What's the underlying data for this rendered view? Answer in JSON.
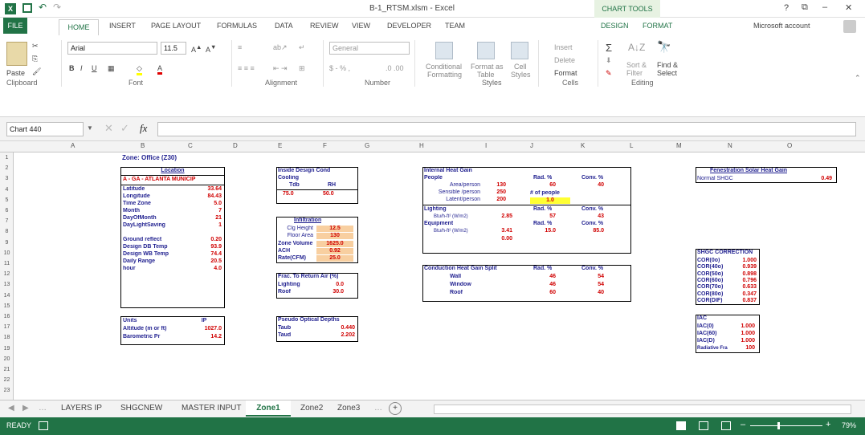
{
  "title": "B-1_RTSM.xlsm - Excel",
  "chart_tools": "CHART TOOLS",
  "window_buttons": {
    "help": "?",
    "restore": "⧉",
    "minimize": "–",
    "close": "✕"
  },
  "tabs": [
    "FILE",
    "HOME",
    "INSERT",
    "PAGE LAYOUT",
    "FORMULAS",
    "DATA",
    "REVIEW",
    "VIEW",
    "DEVELOPER",
    "TEAM",
    "DESIGN",
    "FORMAT"
  ],
  "account": "Microsoft account",
  "ribbon": {
    "paste": "Paste",
    "clipboard": "Clipboard",
    "font_name": "Arial",
    "font_size": "11.5",
    "font": "Font",
    "alignment": "Alignment",
    "number_format": "General",
    "number": "Number",
    "conditional": "Conditional",
    "formatting": "Formatting",
    "format_as": "Format as",
    "table": "Table",
    "cell": "Cell",
    "styles_btn": "Styles",
    "styles": "Styles",
    "insert": "Insert",
    "delete": "Delete",
    "format": "Format",
    "cells": "Cells",
    "sort": "Sort &",
    "filter": "Filter",
    "find": "Find &",
    "select": "Select",
    "editing": "Editing"
  },
  "formula_bar": {
    "name_box": "Chart 440",
    "fx": "fx",
    "value": ""
  },
  "columns": [
    "A",
    "B",
    "C",
    "D",
    "E",
    "F",
    "G",
    "H",
    "I",
    "J",
    "K",
    "L",
    "M",
    "N",
    "O"
  ],
  "rows": [
    "1",
    "2",
    "3",
    "4",
    "5",
    "6",
    "7",
    "8",
    "9",
    "10",
    "11",
    "12",
    "13",
    "14",
    "15",
    "16",
    "17",
    "18",
    "19",
    "20",
    "21",
    "22",
    "23"
  ],
  "zone": "Zone: Office (Z30)",
  "location": {
    "header": "Location",
    "name": "A - GA - ATLANTA MUNICIP",
    "rows": [
      [
        "Latitude",
        "33.64"
      ],
      [
        "Longitude",
        "84.43"
      ],
      [
        "Time Zone",
        "5.0"
      ],
      [
        "Month",
        "7"
      ],
      [
        "DayOfMonth",
        "21"
      ],
      [
        "DayLightSaving",
        "1"
      ],
      [
        "",
        ""
      ],
      [
        "Ground reflect",
        "0.20"
      ],
      [
        "Design DB Temp",
        "93.9"
      ],
      [
        "Design WB Temp",
        "74.4"
      ],
      [
        "Daily Range",
        "20.5"
      ],
      [
        "hour",
        "4.0"
      ]
    ]
  },
  "units": {
    "rows": [
      [
        "Units",
        "IP"
      ],
      [
        "Altitude (m or ft)",
        "1027.0"
      ],
      [
        "Barometric Pr",
        "14.2"
      ]
    ]
  },
  "inside": {
    "header": "Inside Design Cond",
    "cooling": "Cooling",
    "tdb": "Tdb",
    "rh": "RH",
    "tdb_val": "75.0",
    "rh_val": "50.0"
  },
  "infiltration": {
    "header": "Infiltration",
    "rows": [
      [
        "Clg Height",
        "12.5"
      ],
      [
        "Floor Area",
        "130"
      ],
      [
        "Zone Volume",
        "1625.0"
      ],
      [
        "ACH",
        "0.92"
      ],
      [
        "Rate(CFM)",
        "25.0"
      ]
    ]
  },
  "return_air": {
    "header": "Frac. To Return Air (%)",
    "rows": [
      [
        "Lighting",
        "0.0"
      ],
      [
        "Roof",
        "30.0"
      ]
    ]
  },
  "optical": {
    "header": "Pseudo Optical Depths",
    "rows": [
      [
        "Taub",
        "0.440"
      ],
      [
        "Taud",
        "2.202"
      ]
    ]
  },
  "ihg": {
    "header": "Internal Heat Gain",
    "people": "People",
    "rad": "Rad. %",
    "conv": "Conv. %",
    "rows": [
      [
        "Area/person",
        "130"
      ],
      [
        "Sensible /person",
        "250"
      ],
      [
        "Latent/person",
        "200"
      ]
    ],
    "people_rad": "60",
    "people_conv": "40",
    "num_people": "# of people",
    "num_people_val": "1.0",
    "lighting": "Lighting",
    "light_label": "Btu/h-ft² (W/m2)",
    "light_val": "2.85",
    "light_rad": "57",
    "light_conv": "43",
    "equipment": "Equipment",
    "equip_label": "Btu/h-ft² (W/m2)",
    "equip_val": "3.41",
    "equip_extra": "0.00",
    "equip_rad": "15.0",
    "equip_conv": "85.0"
  },
  "conduction": {
    "header": "Conduction Heat Gain Split",
    "rad": "Rad. %",
    "conv": "Conv. %",
    "rows": [
      [
        "Wall",
        "46",
        "54"
      ],
      [
        "Window",
        "46",
        "54"
      ],
      [
        "Roof",
        "60",
        "40"
      ]
    ]
  },
  "fenestration": {
    "header": "Fenestration Solar Heat Gain",
    "label": "Normal SHGC",
    "value": "0.49"
  },
  "shgc": {
    "header": "SHGC CORRECTION",
    "rows": [
      [
        "COR(0o)",
        "1.000"
      ],
      [
        "COR(40o)",
        "0.939"
      ],
      [
        "COR(50o)",
        "0.898"
      ],
      [
        "COR(60o)",
        "0.796"
      ],
      [
        "COR(70o)",
        "0.633"
      ],
      [
        "COR(80o)",
        "0.347"
      ],
      [
        "COR(DIF)",
        "0.837"
      ]
    ]
  },
  "iac": {
    "header": "IAC",
    "rows": [
      [
        "IAC(0)",
        "1.000"
      ],
      [
        "IAC(60)",
        "1.000"
      ],
      [
        "IAC(D)",
        "1.000"
      ],
      [
        "Radiative Fra",
        "100"
      ]
    ]
  },
  "sheets": [
    "LAYERS IP",
    "SHGCNEW",
    "MASTER INPUT",
    "Zone1",
    "Zone2",
    "Zone3"
  ],
  "status": {
    "ready": "READY",
    "zoom": "79%"
  }
}
